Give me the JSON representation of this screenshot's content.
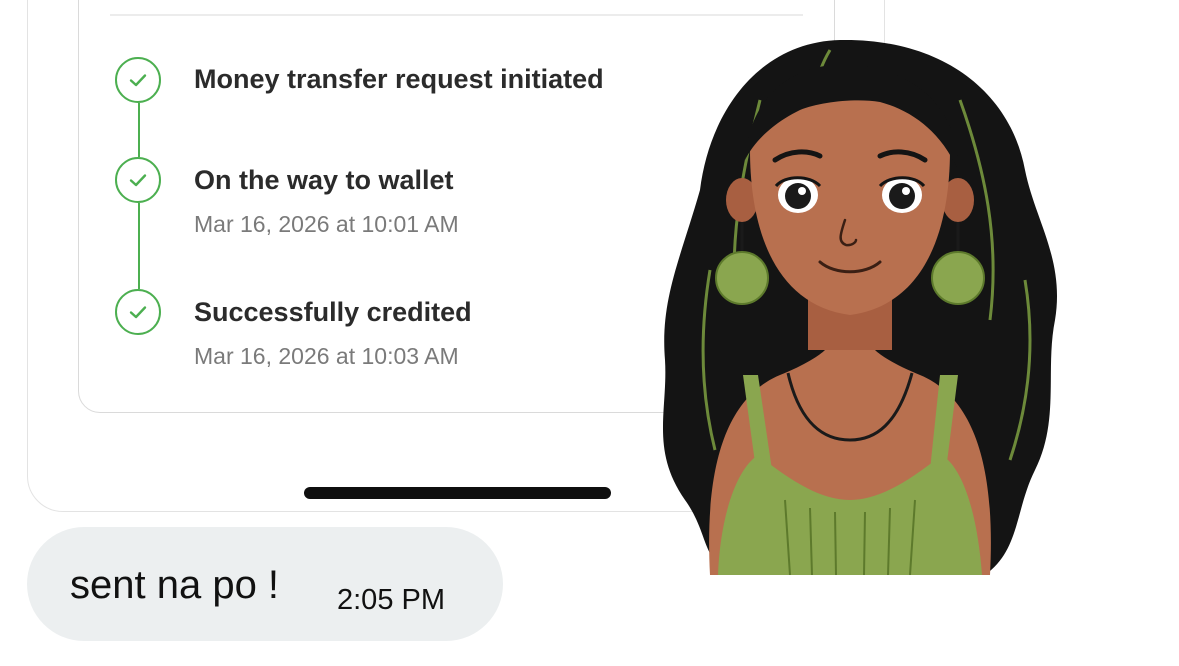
{
  "transfer_status": {
    "steps": [
      {
        "title": "Money transfer request initiated",
        "time": ""
      },
      {
        "title": "On the way to wallet",
        "time": "Mar 16, 2026 at 10:01 AM"
      },
      {
        "title": "Successfully credited",
        "time": "Mar 16, 2026 at 10:03 AM"
      }
    ]
  },
  "message": {
    "text": "sent na po !",
    "time": "2:05 PM"
  },
  "sticker": {
    "icon": "woman-avatar-sticker"
  },
  "colors": {
    "check_green": "#4caf50",
    "bubble_bg": "#eceff0",
    "sticker_hair": "#141414",
    "sticker_skin": "#b8704f",
    "sticker_dress": "#8aa64f"
  }
}
